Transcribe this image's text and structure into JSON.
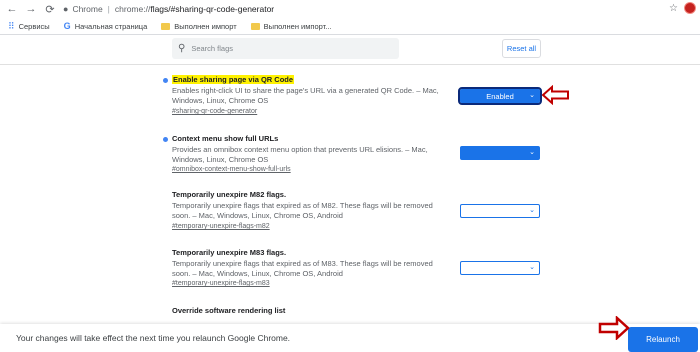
{
  "toolbar": {
    "site_name": "Chrome",
    "url_prefix": "chrome://",
    "url_bold": "flags",
    "url_rest": "/#sharing-qr-code-generator"
  },
  "bookmarks": [
    {
      "label": "Сервисы",
      "icon": "apps-grid-icon"
    },
    {
      "label": "Начальная страница",
      "icon": "google-icon"
    },
    {
      "label": "Выполнен импорт",
      "icon": "folder-icon"
    },
    {
      "label": "Выполнен импорт...",
      "icon": "folder-icon"
    }
  ],
  "header": {
    "search_placeholder": "Search flags",
    "reset_label": "Reset all"
  },
  "flags": [
    {
      "name": "Enable sharing page via QR Code",
      "description": "Enables right-click UI to share the page's URL via a generated QR Code. – Mac, Windows, Linux, Chrome OS",
      "link": "#sharing-qr-code-generator",
      "value": "Enabled",
      "highlighted": true
    },
    {
      "name": "Context menu show full URLs",
      "description": "Provides an omnibox context menu option that prevents URL elisions. – Mac, Windows, Linux, Chrome OS",
      "link": "#omnibox-context-menu-show-full-urls",
      "value": ""
    },
    {
      "name": "Temporarily unexpire M82 flags.",
      "description": "Temporarily unexpire flags that expired as of M82. These flags will be removed soon. – Mac, Windows, Linux, Chrome OS, Android",
      "link": "#temporary-unexpire-flags-m82",
      "value": ""
    },
    {
      "name": "Temporarily unexpire M83 flags.",
      "description": "Temporarily unexpire flags that expired as of M83. These flags will be removed soon. – Mac, Windows, Linux, Chrome OS, Android",
      "link": "#temporary-unexpire-flags-m83",
      "value": ""
    },
    {
      "name": "Override software rendering list"
    }
  ],
  "footer": {
    "message": "Your changes will take effect the next time you relaunch Google Chrome.",
    "relaunch_label": "Relaunch"
  },
  "colors": {
    "accent": "#1a73e8",
    "highlight": "#fff200",
    "annotation_arrow": "#c00000"
  }
}
